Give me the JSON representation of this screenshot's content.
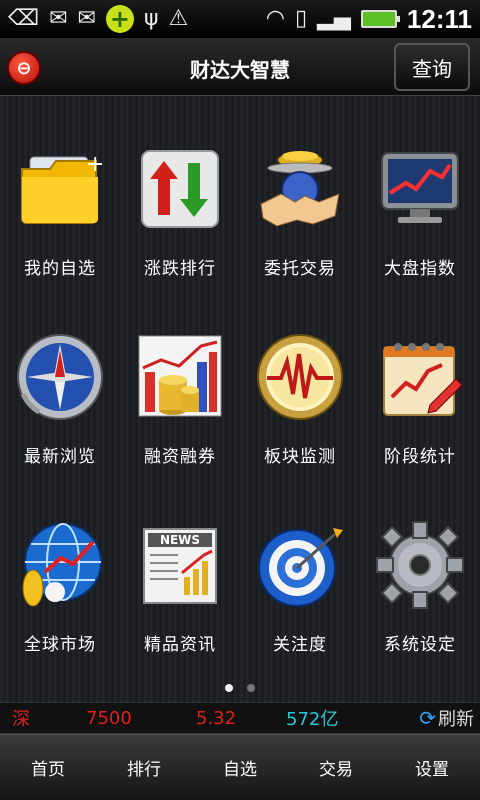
{
  "status_bar": {
    "icons": [
      "back-icon",
      "mail-icon",
      "mail-icon",
      "plus-badge-icon",
      "usb-icon",
      "warning-icon"
    ],
    "time": "12:11"
  },
  "header": {
    "title": "财达大智慧",
    "query_button": "查询"
  },
  "grid": [
    {
      "label": "我的自选",
      "icon": "folder-icon"
    },
    {
      "label": "涨跌排行",
      "icon": "up-down-arrows-icon"
    },
    {
      "label": "委托交易",
      "icon": "handshake-icon"
    },
    {
      "label": "大盘指数",
      "icon": "monitor-chart-icon"
    },
    {
      "label": "最新浏览",
      "icon": "compass-icon"
    },
    {
      "label": "融资融券",
      "icon": "coins-chart-icon"
    },
    {
      "label": "板块监测",
      "icon": "pulse-icon"
    },
    {
      "label": "阶段统计",
      "icon": "notepad-chart-icon"
    },
    {
      "label": "全球市场",
      "icon": "globe-icon"
    },
    {
      "label": "精品资讯",
      "icon": "newspaper-icon"
    },
    {
      "label": "关注度",
      "icon": "target-icon"
    },
    {
      "label": "系统设定",
      "icon": "gear-icon"
    }
  ],
  "news_icon_text": "NEWS",
  "pager": {
    "pages": 2,
    "current": 1
  },
  "ticker": {
    "market": "深",
    "index": "7500",
    "change": "5.32",
    "volume": "572亿",
    "refresh": "刷新"
  },
  "bottom_nav": [
    "首页",
    "排行",
    "自选",
    "交易",
    "设置"
  ]
}
